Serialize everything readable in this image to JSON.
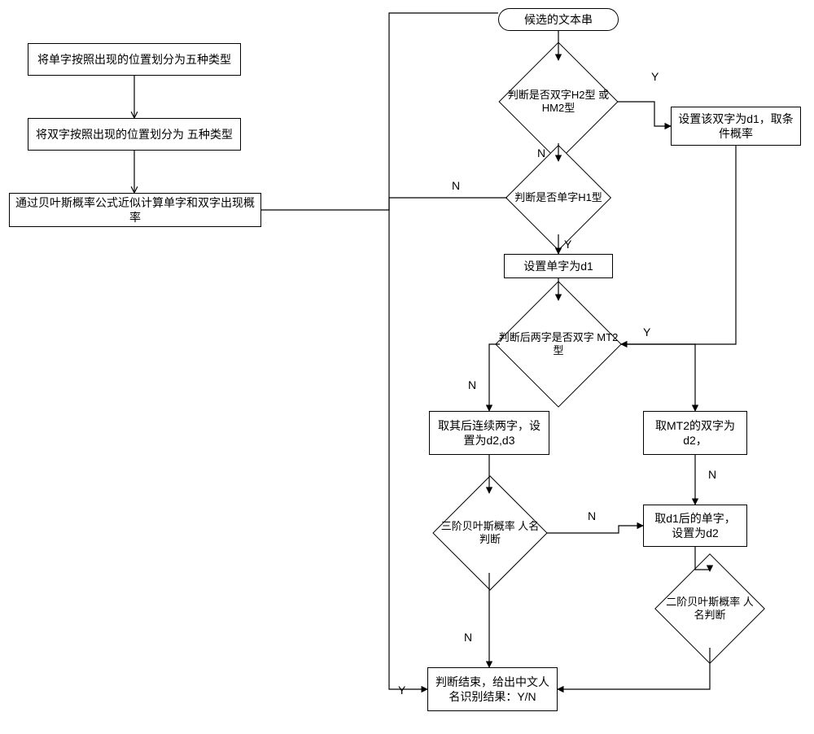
{
  "chart_data": {
    "type": "flowchart",
    "left_sequence": {
      "nodes": [
        {
          "id": "L1",
          "type": "process",
          "text": "将单字按照出现的位置划分为五种类型"
        },
        {
          "id": "L2",
          "type": "process",
          "text": "将双字按照出现的位置划分为 五种类型"
        },
        {
          "id": "L3",
          "type": "process",
          "text": "通过贝叶斯概率公式近似计算单字和双字出现概率"
        }
      ],
      "edges": [
        {
          "from": "L1",
          "to": "L2"
        },
        {
          "from": "L2",
          "to": "L3"
        },
        {
          "from": "L3",
          "to": "R-start"
        }
      ]
    },
    "right_flow": {
      "start": {
        "id": "R-start",
        "type": "terminator",
        "text": "候选的文本串"
      },
      "nodes": [
        {
          "id": "D1",
          "type": "decision",
          "text": "判断是否双字H2型\n或HM2型"
        },
        {
          "id": "P1",
          "type": "process",
          "text": "设置该双字为d1，取条\n件概率"
        },
        {
          "id": "D2",
          "type": "decision",
          "text": "判断是否单字H1型"
        },
        {
          "id": "P2",
          "type": "process",
          "text": "设置单字为d1"
        },
        {
          "id": "D3",
          "type": "decision",
          "text": "判断后两字是否双字\nMT2型"
        },
        {
          "id": "P3",
          "type": "process",
          "text": "取其后连续两字，设\n置为d2,d3"
        },
        {
          "id": "P4",
          "type": "process",
          "text": "取MT2的双字为\nd2，"
        },
        {
          "id": "D4",
          "type": "decision",
          "text": "三阶贝叶斯概率\n人名判断"
        },
        {
          "id": "P5",
          "type": "process",
          "text": "取d1后的单字，\n设置为d2"
        },
        {
          "id": "D5",
          "type": "decision",
          "text": "二阶贝叶斯概率\n人名判断"
        },
        {
          "id": "PF",
          "type": "process",
          "text": "判断结束，给出中文人\n名识别结果：Y/N"
        }
      ],
      "edges": [
        {
          "from": "R-start",
          "to": "D1"
        },
        {
          "from": "D1",
          "to": "P1",
          "label": "Y"
        },
        {
          "from": "D1",
          "to": "D2",
          "label": "N"
        },
        {
          "from": "D2",
          "to": "P2",
          "label": "Y"
        },
        {
          "from": "D2",
          "to": "PF",
          "label": "N"
        },
        {
          "from": "P2",
          "to": "D3"
        },
        {
          "from": "P1",
          "to": "D3"
        },
        {
          "from": "D3",
          "to": "P3",
          "label": "N"
        },
        {
          "from": "D3",
          "to": "P4",
          "label": "Y"
        },
        {
          "from": "P3",
          "to": "D4"
        },
        {
          "from": "P4",
          "to": "D5",
          "label": "N"
        },
        {
          "from": "D4",
          "to": "P5",
          "label": "N"
        },
        {
          "from": "P5",
          "to": "D5"
        },
        {
          "from": "D4",
          "to": "PF",
          "label": "N"
        },
        {
          "from": "D5",
          "to": "PF",
          "label": "Y"
        }
      ]
    }
  },
  "labels": {
    "Y": "Y",
    "N": "N"
  }
}
